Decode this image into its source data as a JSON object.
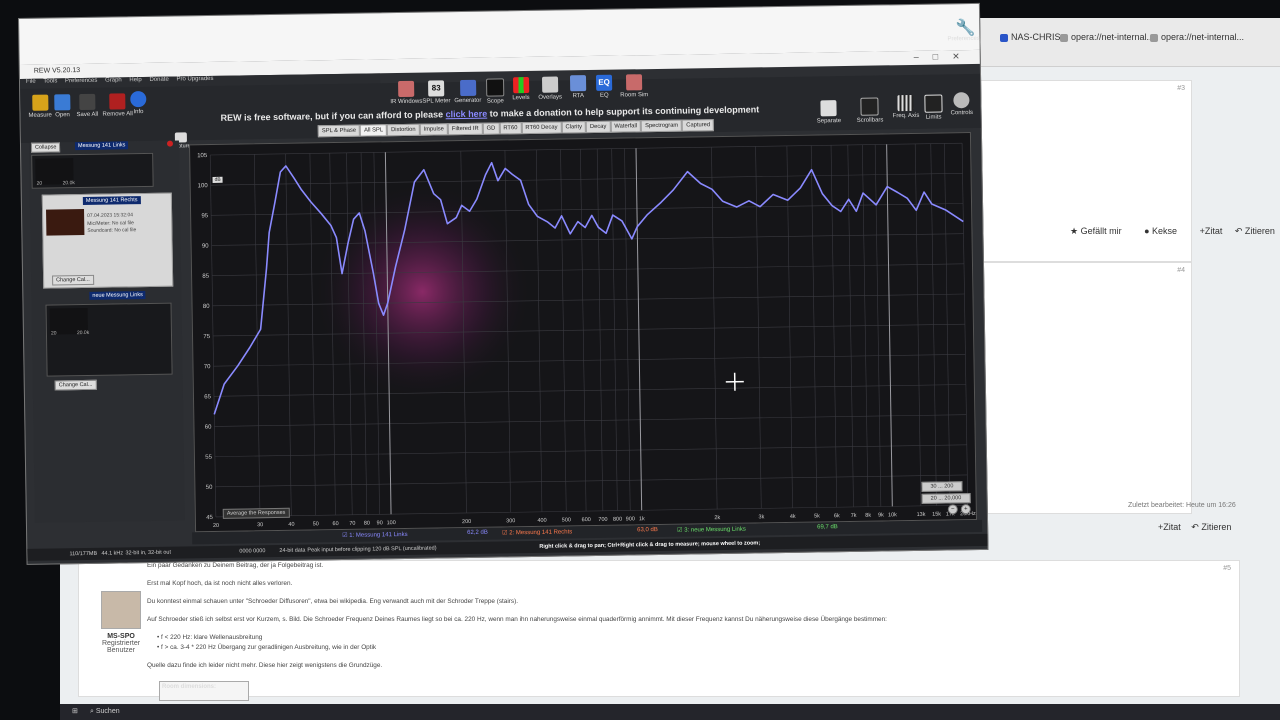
{
  "browser": {
    "bookmarks": [
      "NAS-CHRIS",
      "opera://net-internal...",
      "opera://net-internal..."
    ],
    "forum_actions": {
      "like": "Gefällt mir",
      "cookie": "Kekse",
      "quote": "+Zitat",
      "cite": "Zitieren"
    },
    "edit_note": "Zuletzt bearbeitet: Heute um 16:26",
    "post_numbers": [
      "#3",
      "#4",
      "#5"
    ],
    "post": {
      "author": "MS-SPO",
      "author_role": "Registrierter Benutzer",
      "lines": [
        "Ein paar Gedanken zu Deinem Beitrag, der ja Folgebeitrag ist.",
        "Erst mal Kopf hoch, da ist noch nicht alles verloren.",
        "Du konntest einmal schauen unter \"Schroeder Diffusoren\", etwa bei wikipedia. Eng verwandt auch mit der Schroder Treppe (stairs).",
        "Auf Schroeder stieß ich selbst erst vor Kurzem, s. Bild. Die Schroeder Frequenz Deines Raumes liegt so bei ca. 220 Hz, wenn man ihn naherungsweise einmal quaderförmig annimmt. Mit dieser Frequenz kannst Du näherungsweise diese Übergänge bestimmen:",
        "• f < 220 Hz: klare Wellenausbreitung",
        "• f > ca. 3-4 * 220 Hz Übergang zur geradlinigen Ausbreitung, wie in der Optik",
        "Quelle dazu finde ich leider nicht mehr. Diese hier zeigt wenigstens die Grundzüge."
      ],
      "room_box": "Room dimensions:"
    },
    "taskbar_search": "Suchen"
  },
  "rew": {
    "title": "REW V5.20.13",
    "menu": [
      "File",
      "Tools",
      "Preferences",
      "Graph",
      "Help",
      "Donate",
      "Pro Upgrades"
    ],
    "left_tools": [
      "Measure",
      "Open",
      "Save All",
      "Remove All",
      "Info"
    ],
    "center_tools": [
      "IR Windows",
      "SPL Meter",
      "Generator",
      "Scope",
      "Levels",
      "Overlays",
      "RTA",
      "EQ",
      "Room Sim"
    ],
    "spl_value": "83",
    "right_tools": [
      "Separate",
      "Scrollbars",
      "Freq. Axis",
      "Limits",
      "Controls"
    ],
    "preferences": "Preferences",
    "donate_before": "REW is free software, but if you can afford to please",
    "donate_link": "click here",
    "donate_after": "to make a donation to help support its continuing development",
    "tabs": [
      "SPL & Phase",
      "All SPL",
      "Distortion",
      "Impulse",
      "Filtered IR",
      "GD",
      "RT60",
      "RT60 Decay",
      "Clarity",
      "Decay",
      "Waterfall",
      "Spectrogram",
      "Captured"
    ],
    "active_tab": "All SPL",
    "collapse": "Collapse",
    "capture": "Capture",
    "measurements": [
      {
        "name": "Messung 141 Links"
      },
      {
        "name": "Messung 141 Rechts",
        "date": "07.04.2023 15:32:04",
        "mic": "Mic/Meter: No cal file",
        "soundcard": "Soundcard: No cal file"
      },
      {
        "name": "neue Messung Links"
      }
    ],
    "change_cal": "Change Cal...",
    "thumb_axis": [
      "20",
      "20.0k"
    ],
    "unit": "dB",
    "average_btn": "Average the Responses",
    "range_btns": [
      "30 ... 200",
      "20 ... 20,000"
    ],
    "legend": [
      {
        "label": "1: Messung 141 Links",
        "value": "62,2 dB",
        "color": "#8a8aff"
      },
      {
        "label": "2: Messung 141 Rechts",
        "value": "63,0 dB",
        "color": "#ff7a4d"
      },
      {
        "label": "3: neue Messung Links",
        "value": "69,7 dB",
        "color": "#6be06b"
      }
    ],
    "status": {
      "memory": "110/177MB",
      "rate": "44.1 kHz",
      "bits": "32-bit in, 32-bit out",
      "meter": "0000 0000",
      "bit_data": "24-bit data",
      "clip": "Peak input before clipping 120 dB SPL (uncalibrated)",
      "hint": "Right click & drag to pan; Ctrl+Right click & drag to measure; mouse wheel to zoom;"
    }
  },
  "chart_data": {
    "type": "line",
    "title": "",
    "xlabel": "",
    "ylabel": "",
    "xscale": "log",
    "xlim": [
      20,
      20000
    ],
    "ylim": [
      45,
      105
    ],
    "x_ticks": [
      "20",
      "30",
      "40",
      "50",
      "60",
      "70",
      "80",
      "90",
      "100",
      "200",
      "300",
      "400",
      "500",
      "600",
      "700",
      "800",
      "900",
      "1k",
      "2k",
      "3k",
      "4k",
      "5k",
      "6k",
      "7k",
      "8k",
      "9k",
      "10k",
      "13k",
      "15k",
      "17k",
      "20kHz"
    ],
    "y_ticks": [
      45,
      50,
      55,
      60,
      65,
      70,
      75,
      80,
      85,
      90,
      95,
      100,
      105
    ],
    "series": [
      {
        "name": "1: Messung 141 Links",
        "color": "#8a8aff",
        "x": [
          20,
          22,
          25,
          28,
          31,
          33,
          34,
          36,
          38,
          40,
          43,
          46,
          50,
          55,
          60,
          63,
          66,
          70,
          74,
          78,
          82,
          88,
          92,
          96,
          100,
          108,
          118,
          130,
          142,
          155,
          165,
          175,
          190,
          200,
          215,
          230,
          250,
          265,
          280,
          300,
          320,
          345,
          370,
          400,
          440,
          470,
          500,
          540,
          580,
          620,
          660,
          700,
          750,
          800,
          870,
          950,
          1000,
          1100,
          1250,
          1400,
          1600,
          1800,
          2000,
          2200,
          2500,
          2800,
          3100,
          3500,
          4000,
          4500,
          5000,
          5500,
          6000,
          6500,
          7000,
          7500,
          8000,
          9000,
          10000,
          11000,
          12000,
          13000,
          14000,
          15000,
          17000,
          20000
        ],
        "y": [
          62,
          67,
          70,
          73,
          76,
          86,
          92,
          97,
          102,
          103,
          101,
          99,
          97,
          95,
          93,
          91,
          85,
          90,
          94,
          95,
          92,
          85,
          80,
          78,
          80,
          86,
          92,
          100,
          102,
          98,
          97,
          93,
          94,
          96,
          95,
          97,
          101,
          103,
          100,
          102,
          101,
          100,
          96,
          94,
          93,
          92,
          94,
          91,
          93,
          92,
          94,
          92,
          91,
          94,
          93,
          90,
          92,
          94,
          96,
          98,
          101,
          99,
          98,
          96,
          95,
          96,
          95,
          97,
          96,
          98,
          101,
          97,
          95,
          94,
          96,
          94,
          97,
          95,
          98,
          97,
          96,
          94,
          97,
          95,
          94,
          92
        ]
      }
    ]
  }
}
